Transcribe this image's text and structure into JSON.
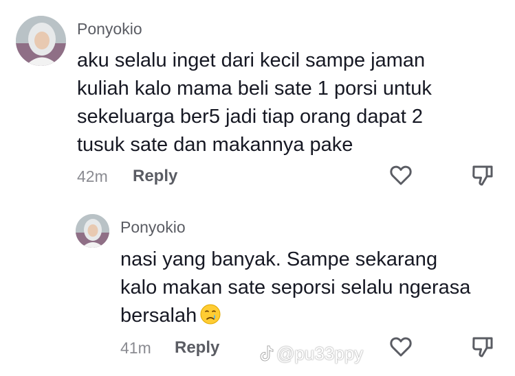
{
  "comments": [
    {
      "username": "Ponyokio",
      "lines": [
        "aku selalu inget dari kecil sampe jaman",
        "kuliah kalo mama beli sate 1 porsi untuk",
        "sekeluarga ber5 jadi tiap orang dapat 2",
        "tusuk sate dan makannya pake"
      ],
      "time": "42m",
      "reply_label": "Reply"
    },
    {
      "username": "Ponyokio",
      "lines": [
        "nasi yang banyak. Sampe sekarang",
        "kalo makan sate seporsi selalu ngerasa",
        "bersalah"
      ],
      "emoji": "crying-face-emoji",
      "time": "41m",
      "reply_label": "Reply"
    }
  ],
  "icons": {
    "like": "heart-outline-icon",
    "dislike": "thumbs-down-outline-icon"
  },
  "watermark": {
    "text": "@pu33ppy",
    "icon": "tiktok-logo-icon"
  },
  "colors": {
    "text": "#161823",
    "username": "#5a5c63",
    "timestamp": "#8a8b91"
  }
}
